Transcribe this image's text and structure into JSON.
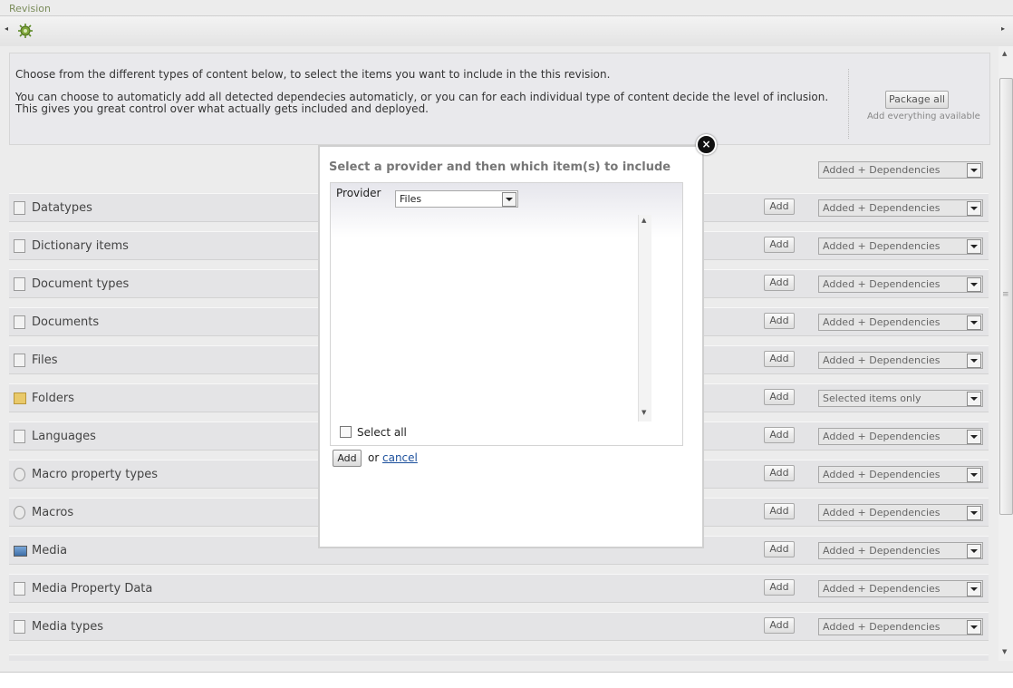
{
  "window": {
    "title": "Revision"
  },
  "toolbar": {
    "left_arrow": "◂",
    "right_arrow": "▸",
    "icon": "gear-bug-icon"
  },
  "info": {
    "line1": "Choose from the different types of content below, to select the items you want to include in the this revision.",
    "line2": "You can choose to automaticly add all detected dependecies automaticly, or you can for each individual type of content decide the level of inclusion. This gives you great control over what actually gets included and deployed.",
    "package_all": "Package all",
    "package_hint": "Add everything available"
  },
  "global_select": "Added + Dependencies",
  "rows": [
    {
      "label": "Datatypes",
      "add": "Add",
      "select": "Added + Dependencies",
      "icon": "datatype-icon"
    },
    {
      "label": "Dictionary items",
      "add": "Add",
      "select": "Added + Dependencies",
      "icon": "dictionary-icon"
    },
    {
      "label": "Document types",
      "add": "Add",
      "select": "Added + Dependencies",
      "icon": "document-type-icon"
    },
    {
      "label": "Documents",
      "add": "Add",
      "select": "Added + Dependencies",
      "icon": "document-icon"
    },
    {
      "label": "Files",
      "add": "Add",
      "select": "Added + Dependencies",
      "icon": "file-icon"
    },
    {
      "label": "Folders",
      "add": "Add",
      "select": "Selected items only",
      "icon": "folder-icon"
    },
    {
      "label": "Languages",
      "add": "Add",
      "select": "Added + Dependencies",
      "icon": "language-icon"
    },
    {
      "label": "Macro property types",
      "add": "Add",
      "select": "Added + Dependencies",
      "icon": "macro-property-icon"
    },
    {
      "label": "Macros",
      "add": "Add",
      "select": "Added + Dependencies",
      "icon": "macro-icon"
    },
    {
      "label": "Media",
      "add": "Add",
      "select": "Added + Dependencies",
      "icon": "media-icon"
    },
    {
      "label": "Media Property Data",
      "add": "Add",
      "select": "Added + Dependencies",
      "icon": "media-property-icon"
    },
    {
      "label": "Media types",
      "add": "Add",
      "select": "Added + Dependencies",
      "icon": "media-type-icon"
    }
  ],
  "modal": {
    "title": "Select a provider and then which item(s) to include",
    "provider_label": "Provider",
    "provider_value": "Files",
    "select_all": "Select all",
    "add": "Add",
    "or": "or",
    "cancel": "cancel",
    "close": "×"
  },
  "scroll": {
    "up": "▲",
    "down": "▼"
  }
}
